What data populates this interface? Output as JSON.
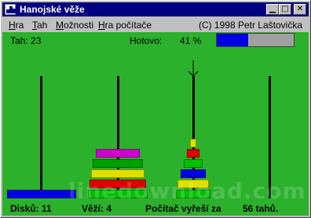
{
  "window": {
    "title": "Hanojské věže"
  },
  "menu": {
    "items": [
      {
        "label_first": "H",
        "label_rest": "ra"
      },
      {
        "label_first": "T",
        "label_rest": "ah"
      },
      {
        "label_first": "M",
        "label_rest": "ožnosti"
      },
      {
        "label_first": "H",
        "label_rest": "ra počítače"
      }
    ],
    "copyright": "(C) 1998  Petr Laštovička"
  },
  "hud": {
    "moves_label": "Tah:",
    "moves_value": "23",
    "done_label": "Hotovo:",
    "done_value": "41 %",
    "progress_fraction": 0.41
  },
  "game": {
    "pegs": [
      "peg-1",
      "peg-2",
      "peg-3",
      "peg-4"
    ],
    "disks_peg1": [
      "#0000e0"
    ],
    "disks_peg2": [
      "#00c000",
      "#e00000",
      "#e0e000",
      "#00a000",
      "#d000d0"
    ],
    "disks_peg3": [
      "#00c000",
      "#e0e000",
      "#0000e0",
      "#00c000",
      "#e00000",
      "#e0e000"
    ],
    "disks_peg4": [],
    "selected_peg_marker": "down-arrow-icon",
    "watermark": "linedownload.com"
  },
  "status": {
    "disks_label": "Disků: 11",
    "towers_label": "Věží: 4",
    "solve_label": "Počítač vyřeší za",
    "solve_value": "56 tahů."
  },
  "colors": {
    "board": "#2bb12b",
    "title_bar": "#000080",
    "progress": "#0000e0"
  }
}
